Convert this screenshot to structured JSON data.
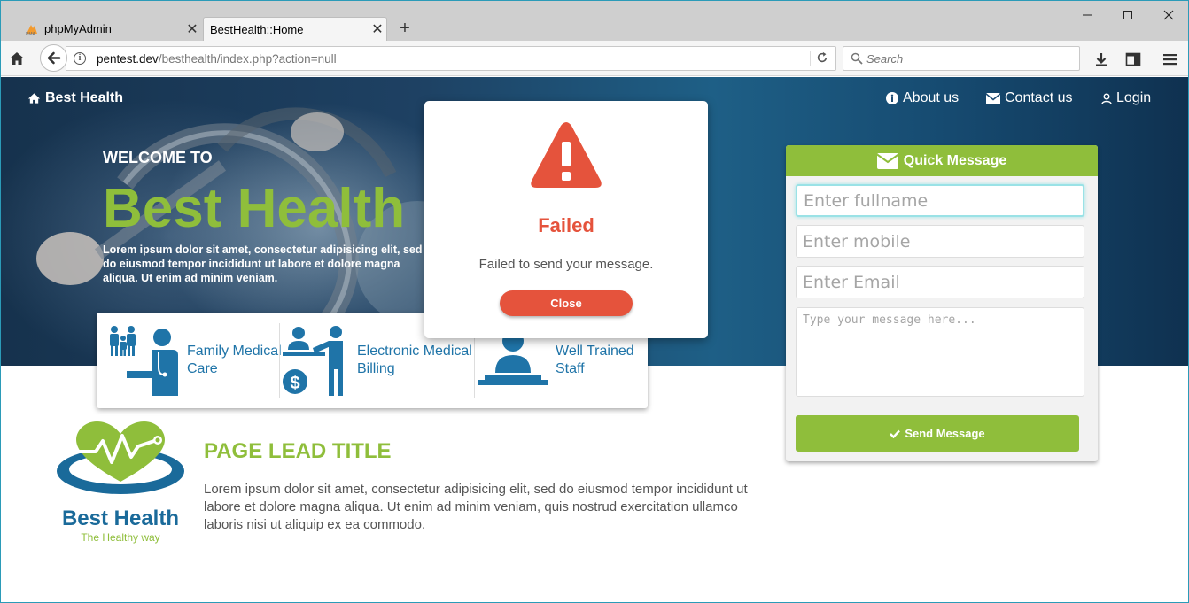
{
  "browser": {
    "tabs": [
      {
        "label": "phpMyAdmin",
        "close": "✕"
      },
      {
        "label": "BestHealth::Home",
        "close": "✕"
      }
    ],
    "new_tab": "+",
    "url_domain": "pentest.dev",
    "url_path": "/besthealth/index.php?action=null",
    "search_placeholder": "Search"
  },
  "site": {
    "brand": "Best Health",
    "nav": [
      {
        "label": "About us",
        "icon": "info-circle-icon"
      },
      {
        "label": "Contact us",
        "icon": "envelope-icon"
      },
      {
        "label": "Login",
        "icon": "user-icon"
      }
    ]
  },
  "hero": {
    "welcome": "WELCOME TO",
    "title": "Best Health",
    "text": "Lorem ipsum dolor sit amet, consectetur adipisicing elit, sed do eiusmod tempor incididunt ut labore et dolore magna aliqua. Ut enim ad minim veniam."
  },
  "features": [
    {
      "label": "Family Medical Care",
      "icon": "family-doctor-icon"
    },
    {
      "label": "Electronic Medical Billing",
      "icon": "billing-icon"
    },
    {
      "label": "Well Trained Staff",
      "icon": "staff-icon"
    }
  ],
  "lead": {
    "logo_name": "Best Health",
    "logo_tagline": "The Healthy way",
    "title": "PAGE LEAD TITLE",
    "text": "Lorem ipsum dolor sit amet, consectetur adipisicing elit, sed do eiusmod tempor incididunt ut labore et dolore magna aliqua. Ut enim ad minim veniam, quis nostrud exercitation ullamco laboris nisi ut aliquip ex ea commodo."
  },
  "quick_message": {
    "title": "Quick Message",
    "fullname_placeholder": "Enter fullname",
    "mobile_placeholder": "Enter mobile",
    "email_placeholder": "Enter Email",
    "message_placeholder": "Type your message here...",
    "send_label": "Send Message"
  },
  "modal": {
    "title": "Failed",
    "text": "Failed to send your message.",
    "close_label": "Close"
  },
  "colors": {
    "accent_green": "#8fbe3b",
    "error_red": "#e5533c",
    "feature_blue": "#1f74a8"
  }
}
